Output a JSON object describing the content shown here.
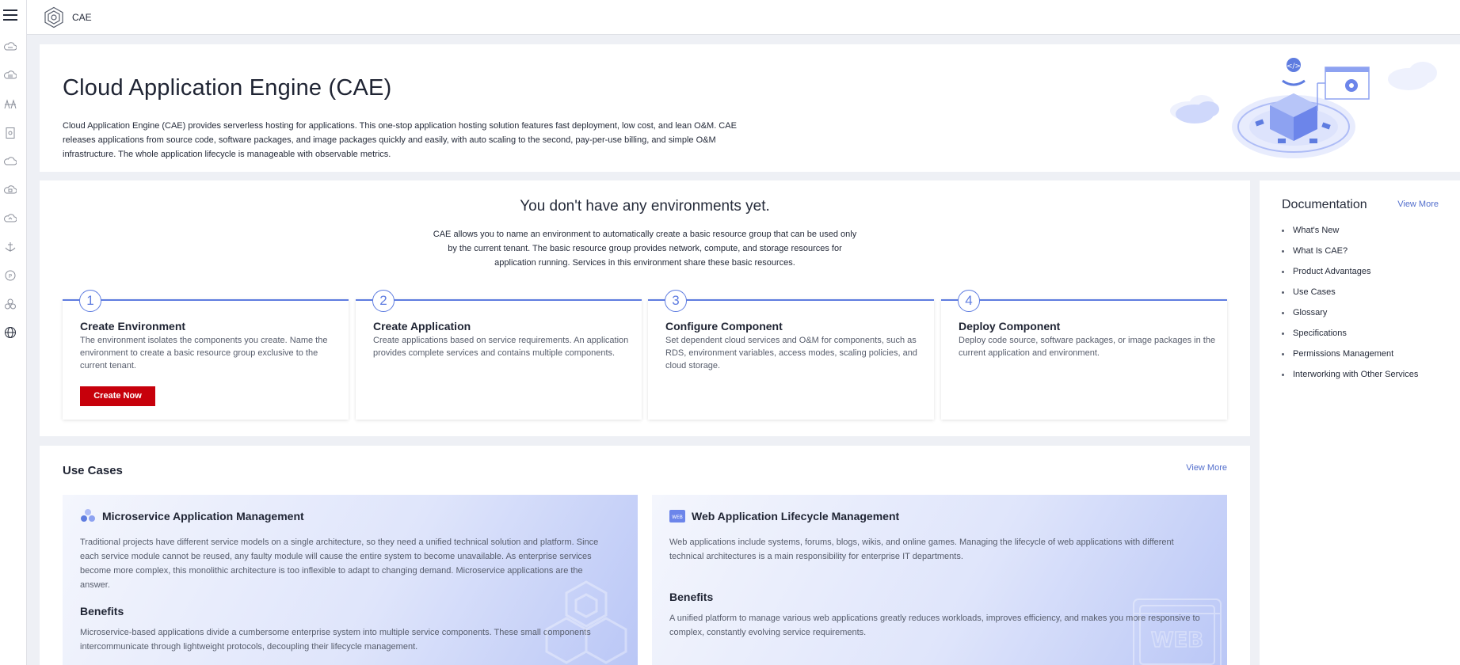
{
  "topbar": {
    "service": "CAE"
  },
  "rail": {
    "icons": [
      "cloud-server-icon",
      "cloud-server-icon",
      "bridge-icon",
      "document-icon",
      "cloud-icon",
      "cloud-storage-icon",
      "cloud-icon",
      "anchor-icon",
      "badge-icon",
      "cluster-icon",
      "globe-icon"
    ]
  },
  "hero": {
    "title": "Cloud Application Engine (CAE)",
    "description": "Cloud Application Engine (CAE) provides serverless hosting for applications. This one-stop application hosting solution features fast deployment, low cost, and lean O&M. CAE releases applications from source code, software packages, and image packages quickly and easily, with auto scaling to the second, pay-per-use billing, and simple O&M infrastructure. The whole application lifecycle is manageable with observable metrics."
  },
  "environments": {
    "title": "You don't have any environments yet.",
    "description": "CAE allows you to name an environment to automatically create a basic resource group that can be used only by the current tenant. The basic resource group provides network, compute, and storage resources for application running. Services in this environment share these basic resources.",
    "steps": [
      {
        "num": "1",
        "title": "Create Environment",
        "desc": "The environment isolates the components you create. Name the environment to create a basic resource group exclusive to the current tenant.",
        "button": "Create Now"
      },
      {
        "num": "2",
        "title": "Create Application",
        "desc": "Create applications based on service requirements. An application provides complete services and contains multiple components."
      },
      {
        "num": "3",
        "title": "Configure Component",
        "desc": "Set dependent cloud services and O&M for components, such as RDS, environment variables, access modes, scaling policies, and cloud storage."
      },
      {
        "num": "4",
        "title": "Deploy Component",
        "desc": "Deploy code source, software packages, or image packages in the current application and environment."
      }
    ]
  },
  "documentation": {
    "title": "Documentation",
    "view_more": "View More",
    "links": [
      "What's New",
      "What Is CAE?",
      "Product Advantages",
      "Use Cases",
      "Glossary",
      "Specifications",
      "Permissions Management",
      "Interworking with Other Services"
    ]
  },
  "use_cases": {
    "title": "Use Cases",
    "view_more": "View More",
    "cards": [
      {
        "icon": "microservice-icon",
        "title": "Microservice Application Management",
        "text": "Traditional projects have different service models on a single architecture, so they need a unified technical solution and platform. Since each service module cannot be reused, any faulty module will cause the entire system to become unavailable. As enterprise services become more complex, this monolithic architecture is too inflexible to adapt to changing demand. Microservice applications are the answer.",
        "benefits_title": "Benefits",
        "benefits": "Microservice-based applications divide a cumbersome enterprise system into multiple service components. These small components intercommunicate through lightweight protocols, decoupling their lifecycle management."
      },
      {
        "icon": "web-icon",
        "icon_text": "WEB",
        "title": "Web Application Lifecycle Management",
        "text": "Web applications include systems, forums, blogs, wikis, and online games. Managing the lifecycle of web applications with different technical architectures is a main responsibility for enterprise IT departments.",
        "benefits_title": "Benefits",
        "benefits": "A unified platform to manage various web applications greatly reduces workloads, improves efficiency, and makes you more responsive to complex, constantly evolving service requirements.",
        "watermark": "WEB"
      }
    ]
  },
  "colors": {
    "accent": "#5e7ce0",
    "link": "#526ecc",
    "primary_button": "#c7000b"
  }
}
